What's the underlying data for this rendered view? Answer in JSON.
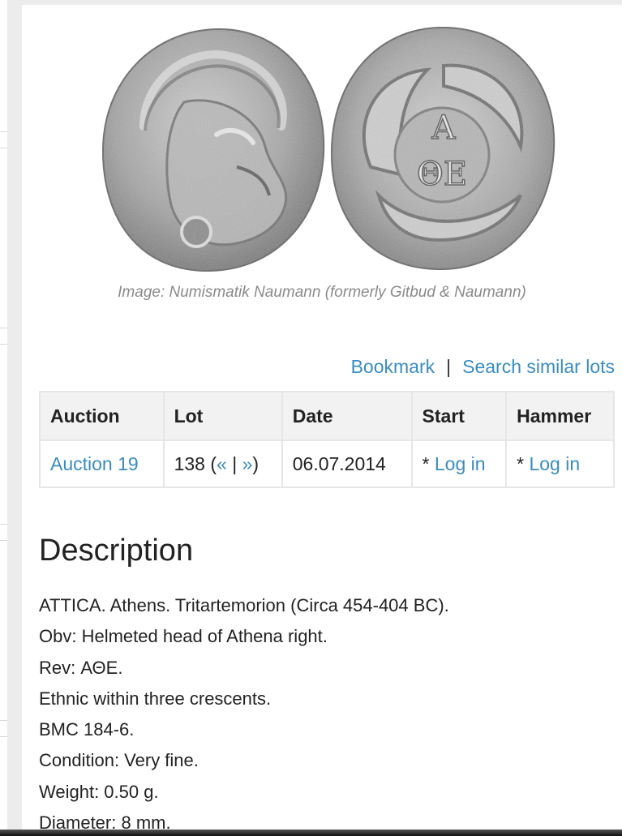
{
  "image": {
    "caption": "Image: Numismatik Naumann (formerly Gitbud & Naumann)",
    "reverse_legend_top": "A",
    "reverse_legend_bottom": "ΘΕ"
  },
  "actions": {
    "bookmark_label": "Bookmark",
    "separator": "|",
    "search_similar_label": "Search similar lots"
  },
  "lots_table": {
    "headers": [
      "Auction",
      "Lot",
      "Date",
      "Start",
      "Hammer"
    ],
    "row": {
      "auction": "Auction 19",
      "lot_number": "138",
      "lot_open": " (",
      "prev_label": "«",
      "pipe": " | ",
      "next_label": "»",
      "lot_close": ")",
      "date": "06.07.2014",
      "start_prefix": "* ",
      "start_link": "Log in",
      "hammer_prefix": "* ",
      "hammer_link": "Log in"
    }
  },
  "description": {
    "title": "Description",
    "lines": [
      "ATTICA. Athens. Tritartemorion (Circa 454-404 BC).",
      "Obv: Helmeted head of Athena right.",
      "Rev: ΑΘΕ.",
      "Ethnic within three crescents.",
      "BMC 184-6.",
      "Condition: Very fine.",
      "Weight: 0.50 g.",
      "Diameter: 8 mm."
    ]
  },
  "colors": {
    "link": "#3a8cbf",
    "caption": "#8a8a8a",
    "table_header_bg": "#f2f2f2",
    "coin_silver": "#a9a9a9"
  }
}
